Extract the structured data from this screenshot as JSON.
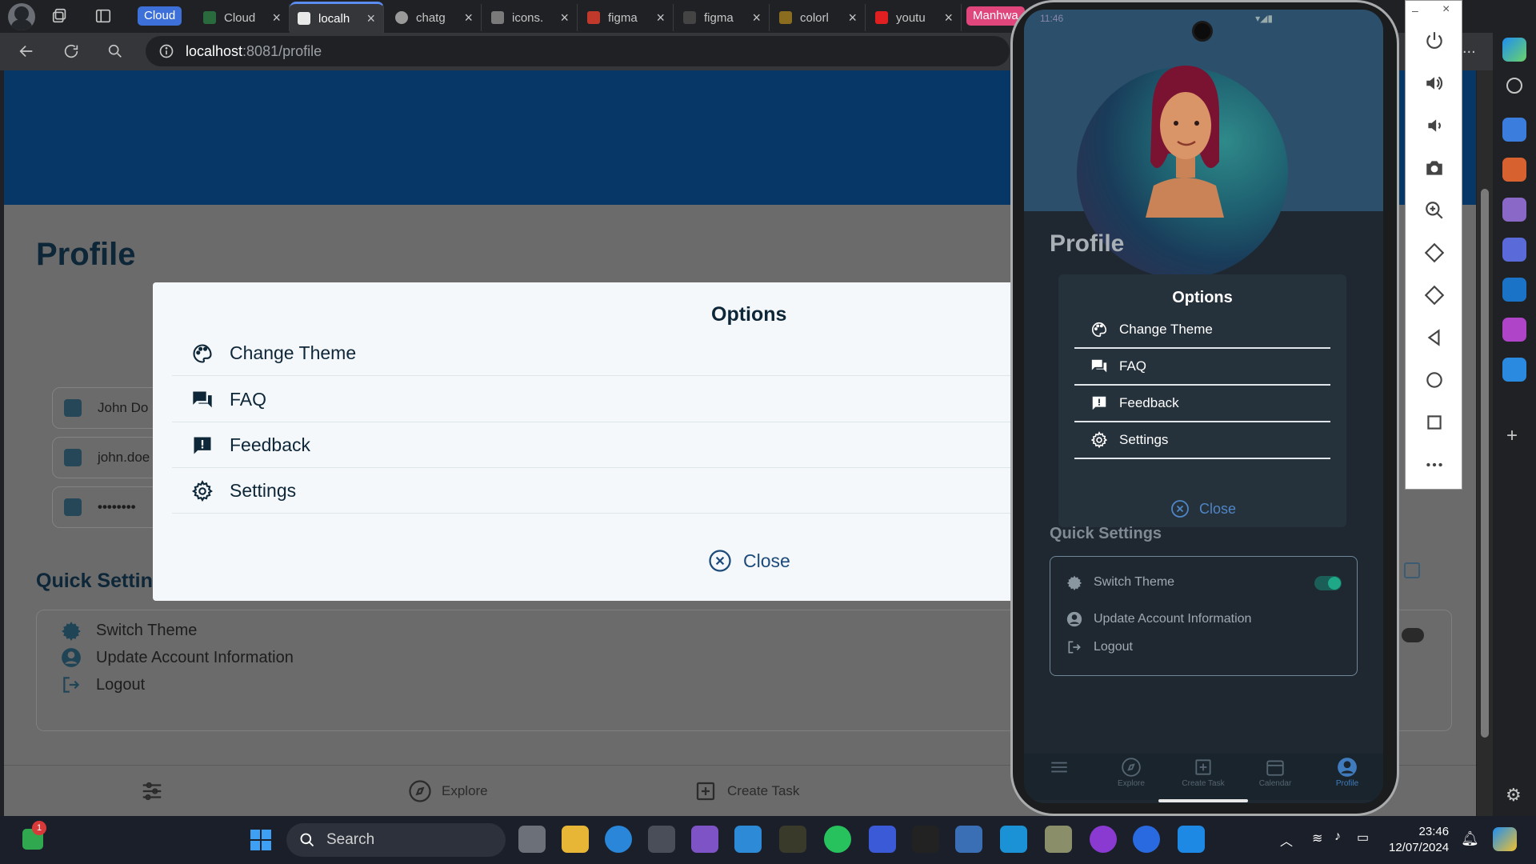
{
  "browser": {
    "tab_group_label": "Cloud",
    "tabs": [
      {
        "label": "Cloud"
      },
      {
        "label": "localh"
      },
      {
        "label": "chatg"
      },
      {
        "label": "icons."
      },
      {
        "label": "figma"
      },
      {
        "label": "figma"
      },
      {
        "label": "colorl"
      },
      {
        "label": "youtu"
      }
    ],
    "pinned_tab_label": "Manhwa",
    "url_host": "localhost",
    "url_path": ":8081/profile",
    "menu_label": "..."
  },
  "web": {
    "page_title": "Profile",
    "fields": [
      {
        "value": "John Do",
        "icon": "contact-icon"
      },
      {
        "value": "john.doe",
        "icon": "id-card-icon"
      },
      {
        "value": "••••••••",
        "icon": "lock-icon"
      }
    ],
    "quick_settings_title": "Quick Settin",
    "quick_settings": [
      {
        "label": "Switch Theme"
      },
      {
        "label": "Update Account Information"
      },
      {
        "label": "Logout"
      }
    ],
    "bottom_tabs": [
      {
        "label": ""
      },
      {
        "label": "Explore"
      },
      {
        "label": "Create Task"
      }
    ],
    "options_modal": {
      "title": "Options",
      "items": [
        {
          "label": "Change Theme",
          "icon": "palette-icon"
        },
        {
          "label": "FAQ",
          "icon": "chat-bubbles-icon"
        },
        {
          "label": "Feedback",
          "icon": "feedback-icon"
        },
        {
          "label": "Settings",
          "icon": "gear-icon"
        }
      ],
      "close_label": "Close"
    },
    "colors": {
      "banner": "#063766",
      "accent": "#1c4a7a",
      "text_dark": "#0d2638"
    }
  },
  "emulator": {
    "status_time": "11:46",
    "page_title": "Profile",
    "options_modal": {
      "title": "Options",
      "items": [
        {
          "label": "Change Theme"
        },
        {
          "label": "FAQ"
        },
        {
          "label": "Feedback"
        },
        {
          "label": "Settings"
        }
      ],
      "close_label": "Close"
    },
    "quick_settings_title": "Quick Settings",
    "quick_settings": [
      {
        "label": "Switch Theme",
        "toggle_on": true
      },
      {
        "label": "Update Account Information"
      },
      {
        "label": "Logout"
      }
    ],
    "nav": [
      {
        "label": ""
      },
      {
        "label": "Explore"
      },
      {
        "label": "Create Task"
      },
      {
        "label": "Calendar"
      },
      {
        "label": "Profile"
      }
    ],
    "toolbar": {
      "minimize_label": "–",
      "close_label": "×",
      "buttons": [
        "power-icon",
        "volume-up-icon",
        "volume-down-icon",
        "camera-icon",
        "zoom-icon",
        "rotate-left-icon",
        "rotate-right-icon",
        "back-icon",
        "home-icon",
        "overview-icon",
        "more-icon"
      ]
    }
  },
  "taskbar": {
    "search_placeholder": "Search",
    "notification_badge": "1",
    "time": "23:46",
    "date": "12/07/2024"
  }
}
